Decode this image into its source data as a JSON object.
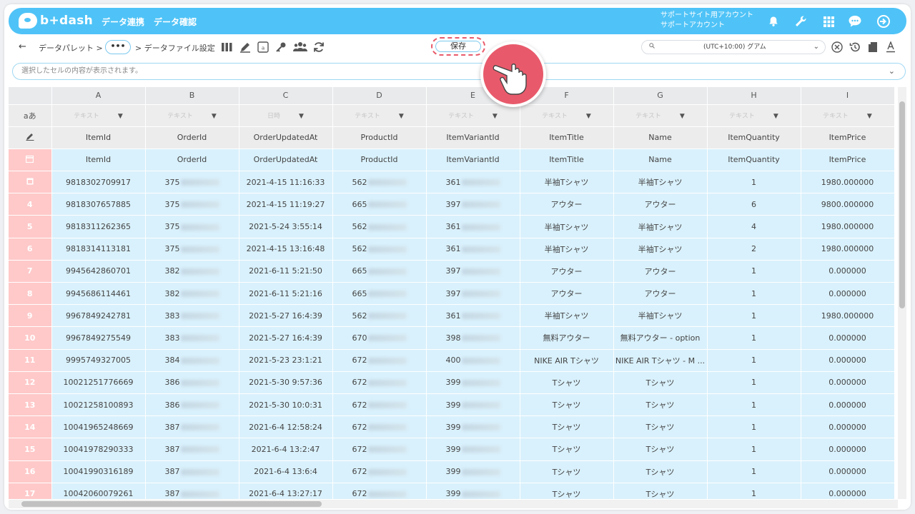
{
  "header": {
    "logo_text": "b+dash",
    "nav": [
      "データ連携",
      "データ確認"
    ],
    "account_line1": "サポートサイト用アカウント",
    "account_line2": "サポートアカウント"
  },
  "toolbar": {
    "back": "←",
    "crumb1": "データパレット >",
    "crumb_more": "•••",
    "crumb2": "> データファイル設定",
    "save_label": "保存",
    "timezone": "(UTC+10:00) グアム"
  },
  "cellbar": {
    "placeholder": "選択したセルの内容が表示されます。"
  },
  "grid": {
    "columns": [
      "A",
      "B",
      "C",
      "D",
      "E",
      "F",
      "G",
      "H",
      "I"
    ],
    "type_row_label": "aあ",
    "types": [
      "テキスト",
      "テキスト",
      "日時",
      "テキスト",
      "テキスト",
      "テキスト",
      "テキスト",
      "テキスト",
      "テキスト"
    ],
    "mapped_names": [
      "ItemId",
      "OrderId",
      "OrderUpdatedAt",
      "ProductId",
      "ItemVariantId",
      "ItemTitle",
      "Name",
      "ItemQuantity",
      "ItemPrice"
    ],
    "header_row": [
      "ItemId",
      "OrderId",
      "OrderUpdatedAt",
      "ProductId",
      "ItemVariantId",
      "ItemTitle",
      "Name",
      "ItemQuantity",
      "ItemPrice"
    ],
    "rows": [
      {
        "n": "",
        "c": [
          "9818302709917",
          "375",
          "2021-4-15 11:16:33",
          "562",
          "361",
          "半袖Tシャツ",
          "半袖Tシャツ",
          "1",
          "1980.000000"
        ]
      },
      {
        "n": "4",
        "c": [
          "9818307657885",
          "375",
          "2021-4-15 11:19:27",
          "665",
          "397",
          "アウター",
          "アウター",
          "6",
          "9800.000000"
        ]
      },
      {
        "n": "5",
        "c": [
          "9818311262365",
          "375",
          "2021-5-24 3:55:14",
          "562",
          "361",
          "半袖Tシャツ",
          "半袖Tシャツ",
          "4",
          "1980.000000"
        ]
      },
      {
        "n": "6",
        "c": [
          "9818314113181",
          "375",
          "2021-4-15 13:16:48",
          "562",
          "361",
          "半袖Tシャツ",
          "半袖Tシャツ",
          "2",
          "1980.000000"
        ]
      },
      {
        "n": "7",
        "c": [
          "9945642860701",
          "382",
          "2021-6-11 5:21:50",
          "665",
          "397",
          "アウター",
          "アウター",
          "1",
          "0.000000"
        ]
      },
      {
        "n": "8",
        "c": [
          "9945686114461",
          "382",
          "2021-6-11 5:21:16",
          "665",
          "397",
          "アウター",
          "アウター",
          "1",
          "0.000000"
        ]
      },
      {
        "n": "9",
        "c": [
          "9967849242781",
          "383",
          "2021-5-27 16:4:39",
          "562",
          "361",
          "半袖Tシャツ",
          "半袖Tシャツ",
          "1",
          "1980.000000"
        ]
      },
      {
        "n": "10",
        "c": [
          "9967849275549",
          "383",
          "2021-5-27 16:4:39",
          "670",
          "398",
          "無料アウター",
          "無料アウター - option",
          "1",
          "0.000000"
        ]
      },
      {
        "n": "11",
        "c": [
          "9995749327005",
          "384",
          "2021-5-23 23:1:21",
          "672",
          "400",
          "NIKE AIR Tシャツ",
          "NIKE AIR Tシャツ - M ...",
          "1",
          "0.000000"
        ]
      },
      {
        "n": "12",
        "c": [
          "10021251776669",
          "386",
          "2021-5-30 9:57:36",
          "672",
          "399",
          "Tシャツ",
          "Tシャツ",
          "1",
          "0.000000"
        ]
      },
      {
        "n": "13",
        "c": [
          "10021258100893",
          "386",
          "2021-5-30 10:0:31",
          "672",
          "399",
          "Tシャツ",
          "Tシャツ",
          "1",
          "0.000000"
        ]
      },
      {
        "n": "14",
        "c": [
          "10041965248669",
          "387",
          "2021-6-4 12:58:24",
          "672",
          "399",
          "Tシャツ",
          "Tシャツ",
          "1",
          "0.000000"
        ]
      },
      {
        "n": "15",
        "c": [
          "10041978290333",
          "387",
          "2021-6-4 13:2:47",
          "672",
          "399",
          "Tシャツ",
          "Tシャツ",
          "1",
          "0.000000"
        ]
      },
      {
        "n": "16",
        "c": [
          "10041990316189",
          "387",
          "2021-6-4 13:6:4",
          "672",
          "399",
          "Tシャツ",
          "Tシャツ",
          "1",
          "0.000000"
        ]
      },
      {
        "n": "17",
        "c": [
          "10042060079261",
          "387",
          "2021-6-4 13:27:17",
          "672",
          "399",
          "Tシャツ",
          "Tシャツ",
          "1",
          "0.000000"
        ]
      }
    ]
  },
  "colors": {
    "accent": "#4fc3f7",
    "row_number_bg": "#ffc9c9",
    "body_bg": "#d9f1fc",
    "highlight": "#e85a6b"
  },
  "icons": [
    "bell-icon",
    "wrench-icon",
    "grid-icon",
    "chat-icon",
    "logout-icon"
  ]
}
